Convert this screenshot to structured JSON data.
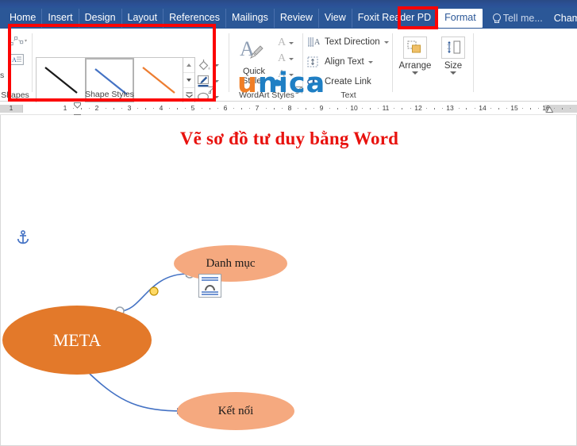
{
  "window": {
    "tabs": [
      {
        "label": "Home",
        "active": false
      },
      {
        "label": "Insert",
        "active": false
      },
      {
        "label": "Design",
        "active": false
      },
      {
        "label": "Layout",
        "active": false
      },
      {
        "label": "References",
        "active": false
      },
      {
        "label": "Mailings",
        "active": false
      },
      {
        "label": "Review",
        "active": false
      },
      {
        "label": "View",
        "active": false
      },
      {
        "label": "Foxit Reader PD",
        "active": false
      },
      {
        "label": "Format",
        "active": true
      }
    ],
    "tell_me": "Tell me...",
    "tell_me_icon": "lightbulb-icon",
    "user_name": "Cham Yoko",
    "share_icon": "share-person-icon"
  },
  "ribbon": {
    "groups": [
      {
        "name": "shapes",
        "label": "Shapes"
      },
      {
        "name": "shape_styles",
        "label": "Shape Styles"
      },
      {
        "name": "wordart_styles",
        "label": "WordArt Styles"
      },
      {
        "name": "text",
        "label": "Text"
      }
    ],
    "shapes_group": {
      "label": "Shapes",
      "side_text": "s",
      "icons": [
        "edit-shape-icon",
        "text-box-icon"
      ]
    },
    "shape_styles": {
      "label": "Shape Styles",
      "gallery_items": [
        {
          "name": "style-line-black",
          "color": "#1a1a1a",
          "selected": false
        },
        {
          "name": "style-line-blue",
          "color": "#4472c4",
          "selected": true
        },
        {
          "name": "style-line-orange",
          "color": "#ed7d31",
          "selected": false
        }
      ],
      "scroll_up": "scroll-up-icon",
      "scroll_down": "scroll-down-icon",
      "more": "more-styles-icon",
      "fill_icon": "shape-fill-icon",
      "outline_icon": "shape-outline-icon",
      "effects_icon": "shape-effects-icon",
      "dialog_launcher": "dialog-launcher-icon"
    },
    "wordart": {
      "quick_styles_label": "Quick Styles",
      "group_label": "WordArt Styles",
      "text_fill_icon": "text-fill-icon",
      "text_outline_icon": "text-outline-icon",
      "text_effects_icon": "text-effects-icon",
      "dialog_launcher": "dialog-launcher-icon"
    },
    "text_group": {
      "label": "Text",
      "items": [
        {
          "label": "Text Direction",
          "icon": "text-direction-icon",
          "has_caret": true
        },
        {
          "label": "Align Text",
          "icon": "align-text-icon",
          "has_caret": true
        },
        {
          "label": "Create Link",
          "icon": "create-link-icon",
          "has_caret": false
        }
      ]
    },
    "arrange": {
      "label": "Arrange",
      "icon": "arrange-icon"
    },
    "size": {
      "label": "Size",
      "icon": "size-icon"
    }
  },
  "annotations": [
    {
      "name": "shape-styles-highlight",
      "color": "#fc0404"
    },
    {
      "name": "format-tab-highlight",
      "color": "#fc0404"
    }
  ],
  "ruler": {
    "numbers": [
      1,
      1,
      2,
      3,
      4,
      5,
      6,
      7,
      8,
      9,
      10,
      11,
      12,
      13,
      14,
      15,
      16
    ],
    "indent_markers": [
      "first-line-indent-marker",
      "hanging-indent-marker",
      "right-indent-marker"
    ]
  },
  "document": {
    "title": "Vẽ sơ đồ tư duy bằng Word",
    "title_color": "#e8120e",
    "anchor_icon": "object-anchor-icon",
    "layout_options_icon": "layout-options-icon",
    "nodes": [
      {
        "name": "node-meta",
        "label": "META",
        "fill": "#e3792a",
        "text_color": "#ffffff"
      },
      {
        "name": "node-danh-muc",
        "label": "Danh mục",
        "fill": "#f5a97f",
        "text_color": "#1a1a1a"
      },
      {
        "name": "node-ket-noi",
        "label": "Kết nối",
        "fill": "#f5a97f",
        "text_color": "#1a1a1a"
      }
    ],
    "connectors": [
      {
        "name": "connector-meta-danhmuc",
        "color": "#4472c4",
        "selected": true,
        "handles": [
          "start-handle",
          "adjust-handle",
          "end-handle"
        ]
      },
      {
        "name": "connector-meta-ketnoi",
        "color": "#4472c4",
        "selected": false,
        "arrow": true
      }
    ]
  },
  "watermark": {
    "first": "u",
    "rest": "nica",
    "cap_icon": "graduation-cap-icon"
  }
}
